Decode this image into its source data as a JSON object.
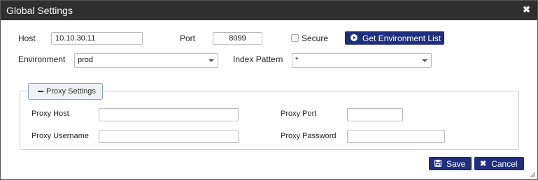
{
  "dialog": {
    "title": "Global Settings",
    "close_icon": "close-icon"
  },
  "connection": {
    "host_label": "Host",
    "host_value": "10.10.30.11",
    "port_label": "Port",
    "port_value": "8099",
    "secure_label": "Secure",
    "secure_checked": false,
    "get_env_label": "Get Environment List",
    "get_env_icon": "play-circle-icon",
    "environment_label": "Environment",
    "environment_value": "prod",
    "index_pattern_label": "Index Pattern",
    "index_pattern_value": "*"
  },
  "proxy": {
    "legend": "Proxy Settings",
    "host_label": "Proxy Host",
    "host_value": "",
    "port_label": "Proxy Port",
    "port_value": "",
    "username_label": "Proxy Username",
    "username_value": "",
    "password_label": "Proxy Password",
    "password_value": ""
  },
  "footer": {
    "save_label": "Save",
    "save_icon": "save-icon",
    "cancel_label": "Cancel",
    "cancel_icon": "close-icon"
  },
  "colors": {
    "titlebar": "#2f2f2f",
    "primary_button": "#1f2f80"
  }
}
